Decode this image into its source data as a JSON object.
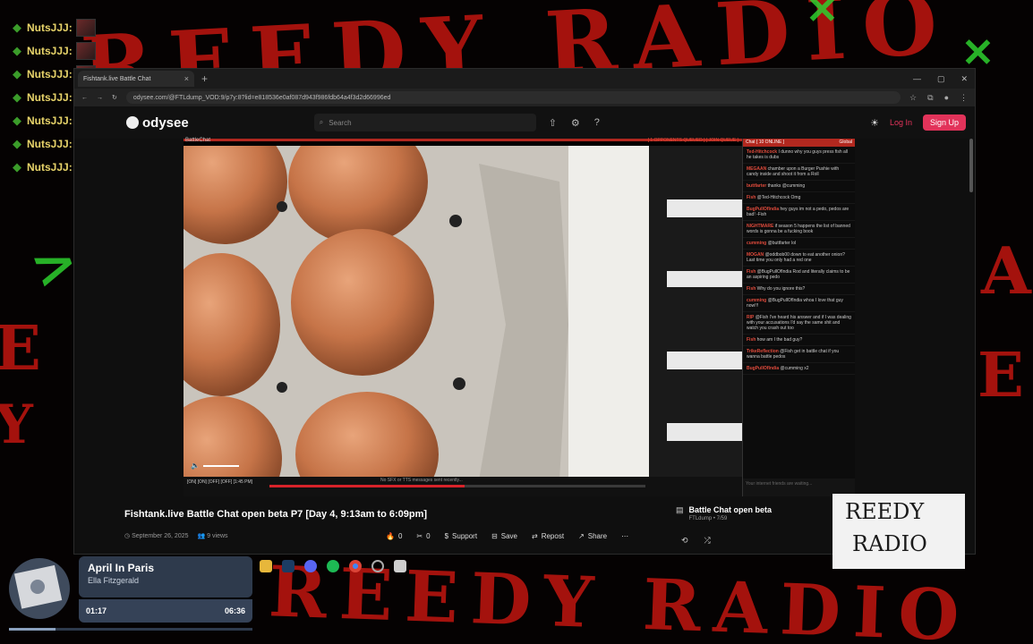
{
  "overlay_chat": {
    "names": [
      "NutsJJJ:",
      "NutsJJJ:",
      "NutsJJJ:",
      "NutsJJJ:",
      "NutsJJJ:",
      "NutsJJJ:",
      "NutsJJJ:"
    ]
  },
  "browser": {
    "tab_title": "Fishtank.live Battle Chat",
    "url": "odysee.com/@FTLdump_VOD:9/p7y:8?lid=e818536e0af087d943f986fdb64a4f3d2d66996ed"
  },
  "site": {
    "logo": "odysee",
    "search_placeholder": "Search",
    "login_label": "Log In",
    "signup_label": "Sign Up"
  },
  "player": {
    "label": "BattleChat",
    "queue_text": "[ 1 OPPONENTS QUEUED ]  [ JOIN QUEUE ]",
    "status_text": "No SFX or TTS messages sent recently...",
    "chat_header": "Chat [ 10 ONLINE ]",
    "chat_global": "Global",
    "chat_input_placeholder": "Your internet friends are waiting...",
    "progress_fraction": 0.52
  },
  "chat_messages": [
    {
      "user": "Ted-Hitchcock",
      "text": "I dunno why you guys press fish all he takes is dubs"
    },
    {
      "user": "MEGAAN",
      "text": "chamber upon a Burger Pushie with candy inside and shoot it from a Roll"
    },
    {
      "user": "buttfarter",
      "text": "thanks @cumming"
    },
    {
      "user": "Fish",
      "text": "@Ted-Hitchcock Omg"
    },
    {
      "user": "BugPullOfIndia",
      "text": "hey guys im not a pedo, pedos are bad! -Fish"
    },
    {
      "user": "NIGHTMARE",
      "text": "if season 5 happens the list of banned words is gonna be a fucking book"
    },
    {
      "user": "cumming",
      "text": "@buttfarter lol"
    },
    {
      "user": "MOGAN",
      "text": "@oddbob00 down to eat another onion? Last time you only had a red one"
    },
    {
      "user": "Fish",
      "text": "@BugPullOfIndia Rod and literally claims to be an aspiring pedo"
    },
    {
      "user": "Fish",
      "text": "Why do you ignore this?"
    },
    {
      "user": "cumming",
      "text": "@BugPullOfIndia whoa I love that guy now!!!"
    },
    {
      "user": "RIP",
      "text": "@Fish I've heard his answer and if I was dealing with your accusations I'd say the same shit and watch you crash out too"
    },
    {
      "user": "Fish",
      "text": "how am I the bad guy?"
    },
    {
      "user": "TrikeReflection",
      "text": "@Fish get in battle chat if you wanna battle pedos"
    },
    {
      "user": "BugPullOfIndia",
      "text": "@cumming x2"
    }
  ],
  "video": {
    "title": "Fishtank.live Battle Chat open beta P7 [Day 4, 9:13am to 6:09pm]",
    "date": "September 26, 2025",
    "views": "9 views",
    "likes": "0",
    "dislikes": "0",
    "support_label": "Support",
    "save_label": "Save",
    "repost_label": "Repost",
    "share_label": "Share"
  },
  "playlist": {
    "title": "Battle Chat open beta",
    "subtitle": "FTLdump • 7/59"
  },
  "music": {
    "song": "April In Paris",
    "artist": "Ella Fitzgerald",
    "elapsed": "01:17",
    "duration": "06:36",
    "progress_fraction": 0.19
  },
  "reedy_logo": {
    "line1": "REEDY",
    "line2": "RADIO"
  },
  "background_text": {
    "top": "REEDY RADIO",
    "bottom": "REEDY RADIO"
  },
  "colors": {
    "accent": "#e2335a",
    "scribble_red": "#c0150f",
    "scribble_green": "#2ed02e",
    "music_bg": "#2e3a4c"
  }
}
